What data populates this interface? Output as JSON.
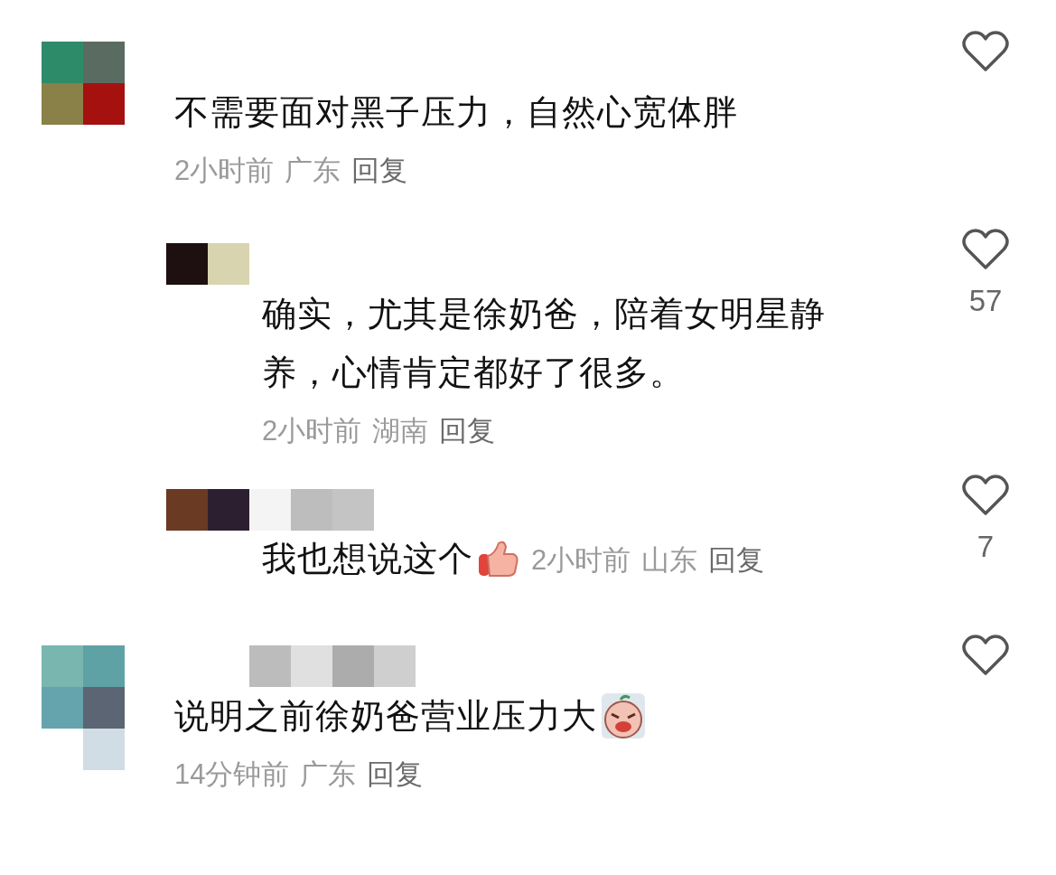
{
  "comments": [
    {
      "kind": "comment",
      "text": "不需要面对黑子压力，自然心宽体胖",
      "time": "2小时前",
      "location": "广东",
      "reply_label": "回复"
    },
    {
      "kind": "reply",
      "text": "确实，尤其是徐奶爸，陪着女明星静养，心情肯定都好了很多。",
      "time": "2小时前",
      "location": "湖南",
      "reply_label": "回复",
      "likes": "57"
    },
    {
      "kind": "reply_inline",
      "text": "我也想说这个",
      "time": "2小时前",
      "location": "山东",
      "reply_label": "回复",
      "likes": "7"
    },
    {
      "kind": "comment",
      "text": "说明之前徐奶爸营业压力大",
      "time": "14分钟前",
      "location": "广东",
      "reply_label": "回复"
    }
  ]
}
